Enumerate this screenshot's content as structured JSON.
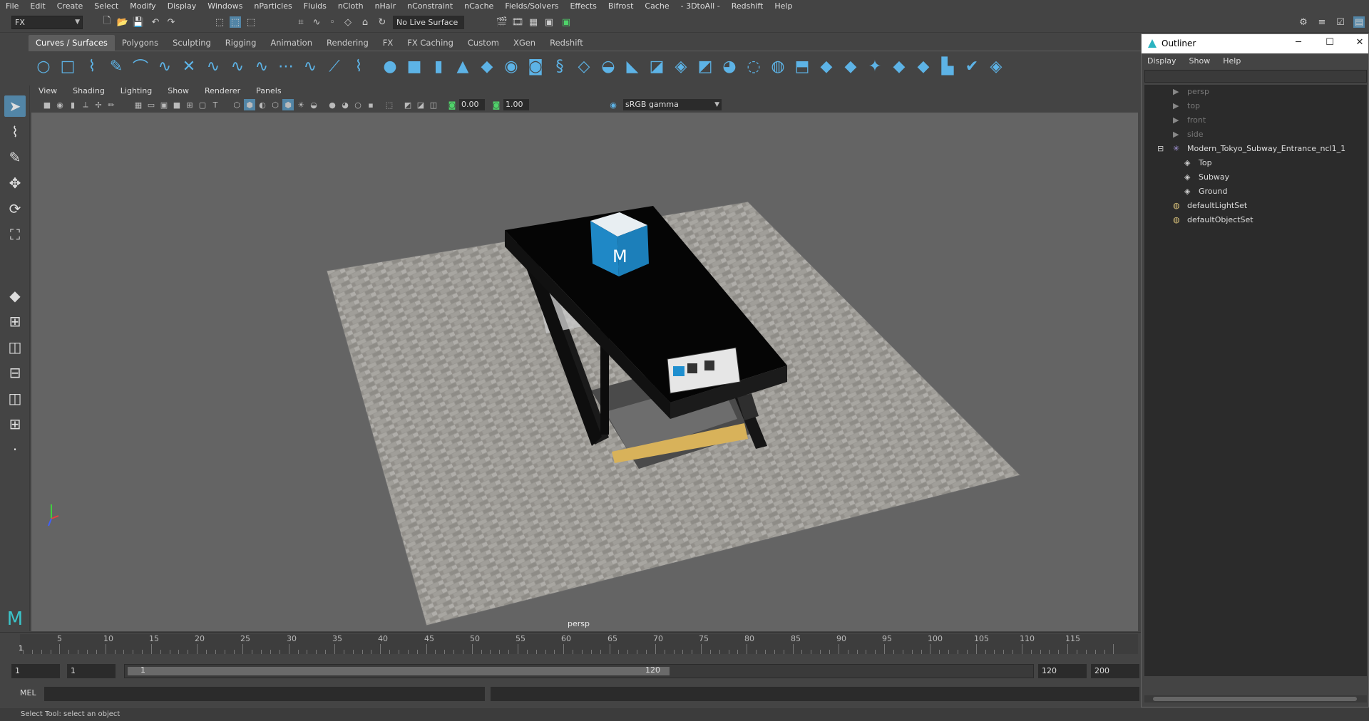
{
  "menu": [
    "File",
    "Edit",
    "Create",
    "Select",
    "Modify",
    "Display",
    "Windows",
    "nParticles",
    "Fluids",
    "nCloth",
    "nHair",
    "nConstraint",
    "nCache",
    "Fields/Solvers",
    "Effects",
    "Bifrost",
    "Cache",
    "- 3DtoAll -",
    "Redshift",
    "Help"
  ],
  "status": {
    "mode": "FX",
    "live_surface": "No Live Surface"
  },
  "shelf_tabs": [
    "Curves / Surfaces",
    "Polygons",
    "Sculpting",
    "Rigging",
    "Animation",
    "Rendering",
    "FX",
    "FX Caching",
    "Custom",
    "XGen",
    "Redshift"
  ],
  "shelf_active": "Curves / Surfaces",
  "panel_menu": [
    "View",
    "Shading",
    "Lighting",
    "Show",
    "Renderer",
    "Panels"
  ],
  "panel_tools": {
    "exposure": "0.00",
    "gamma_value": "1.00",
    "colorspace": "sRGB gamma"
  },
  "viewport": {
    "camera": "persp"
  },
  "timeline": {
    "ticks": [
      "5",
      "10",
      "15",
      "20",
      "25",
      "30",
      "35",
      "40",
      "45",
      "50",
      "55",
      "60",
      "65",
      "70",
      "75",
      "80",
      "85",
      "90",
      "95",
      "100",
      "105",
      "110",
      "115"
    ],
    "current": "1"
  },
  "range": {
    "start": "1",
    "anim_start": "1",
    "slider_start": "1",
    "slider_end": "120",
    "anim_end": "120",
    "end": "200"
  },
  "cmd": {
    "lang": "MEL"
  },
  "help_line": "Select Tool: select an object",
  "outliner": {
    "title": "Outliner",
    "menu": [
      "Display",
      "Show",
      "Help"
    ],
    "items": [
      {
        "label": "persp",
        "icon": "camera-icon",
        "dim": true
      },
      {
        "label": "top",
        "icon": "camera-icon",
        "dim": true
      },
      {
        "label": "front",
        "icon": "camera-icon",
        "dim": true
      },
      {
        "label": "side",
        "icon": "camera-icon",
        "dim": true
      },
      {
        "label": "Modern_Tokyo_Subway_Entrance_ncl1_1",
        "icon": "group-icon",
        "dim": false
      },
      {
        "label": "Top",
        "icon": "mesh-icon",
        "dim": false
      },
      {
        "label": "Subway",
        "icon": "mesh-icon",
        "dim": false
      },
      {
        "label": "Ground",
        "icon": "mesh-icon",
        "dim": false
      },
      {
        "label": "defaultLightSet",
        "icon": "set-icon",
        "dim": false
      },
      {
        "label": "defaultObjectSet",
        "icon": "set-icon",
        "dim": false
      }
    ]
  },
  "colors": {
    "accent": "#5285a6",
    "shelf_icon": "#5db3e6",
    "bg": "#444444",
    "viewport_bg": "#646464"
  }
}
